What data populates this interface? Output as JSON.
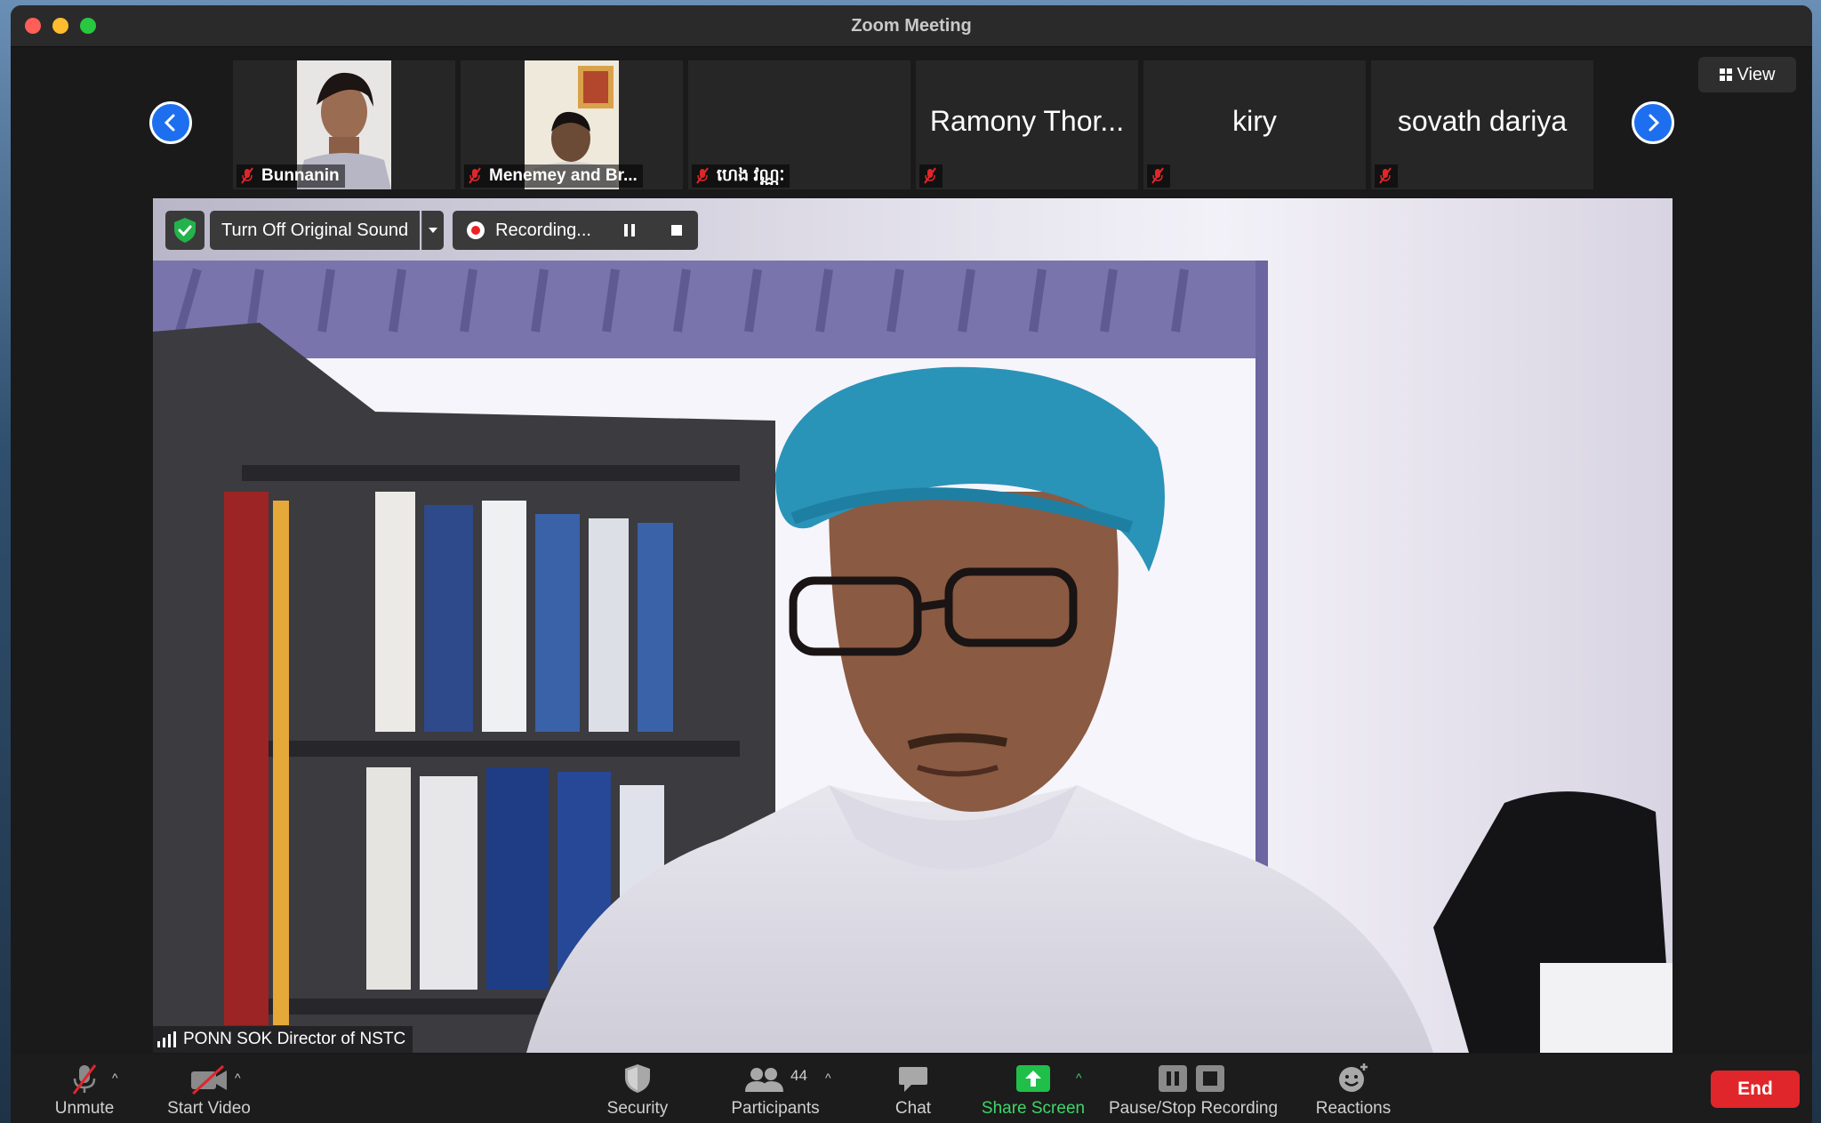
{
  "window": {
    "title": "Zoom Meeting"
  },
  "view_button": {
    "label": "View"
  },
  "participants_strip": [
    {
      "name": "Bunnanin",
      "big_name": "",
      "muted": true,
      "has_video": true
    },
    {
      "name": "Menemey and Br...",
      "big_name": "",
      "muted": true,
      "has_video": true
    },
    {
      "name": "ហេង វណ្ណៈ",
      "big_name": "",
      "muted": true,
      "has_video": false
    },
    {
      "name": "",
      "big_name": "Ramony Thor...",
      "muted": true,
      "has_video": false
    },
    {
      "name": "",
      "big_name": "kiry",
      "muted": true,
      "has_video": false
    },
    {
      "name": "",
      "big_name": "sovath dariya",
      "muted": true,
      "has_video": false
    }
  ],
  "video_overlay": {
    "original_sound_label": "Turn Off Original Sound",
    "recording_label": "Recording..."
  },
  "active_speaker": {
    "label": "PONN SOK Director of NSTC"
  },
  "toolbar": {
    "unmute": "Unmute",
    "start_video": "Start Video",
    "security": "Security",
    "participants": "Participants",
    "participants_count": "44",
    "chat": "Chat",
    "share_screen": "Share Screen",
    "pause_stop_recording": "Pause/Stop Recording",
    "reactions": "Reactions",
    "end": "End"
  },
  "colors": {
    "accent_blue": "#1e6ff0",
    "share_green": "#1fbf4a",
    "end_red": "#e0262a",
    "muted_red": "#e0262a"
  }
}
